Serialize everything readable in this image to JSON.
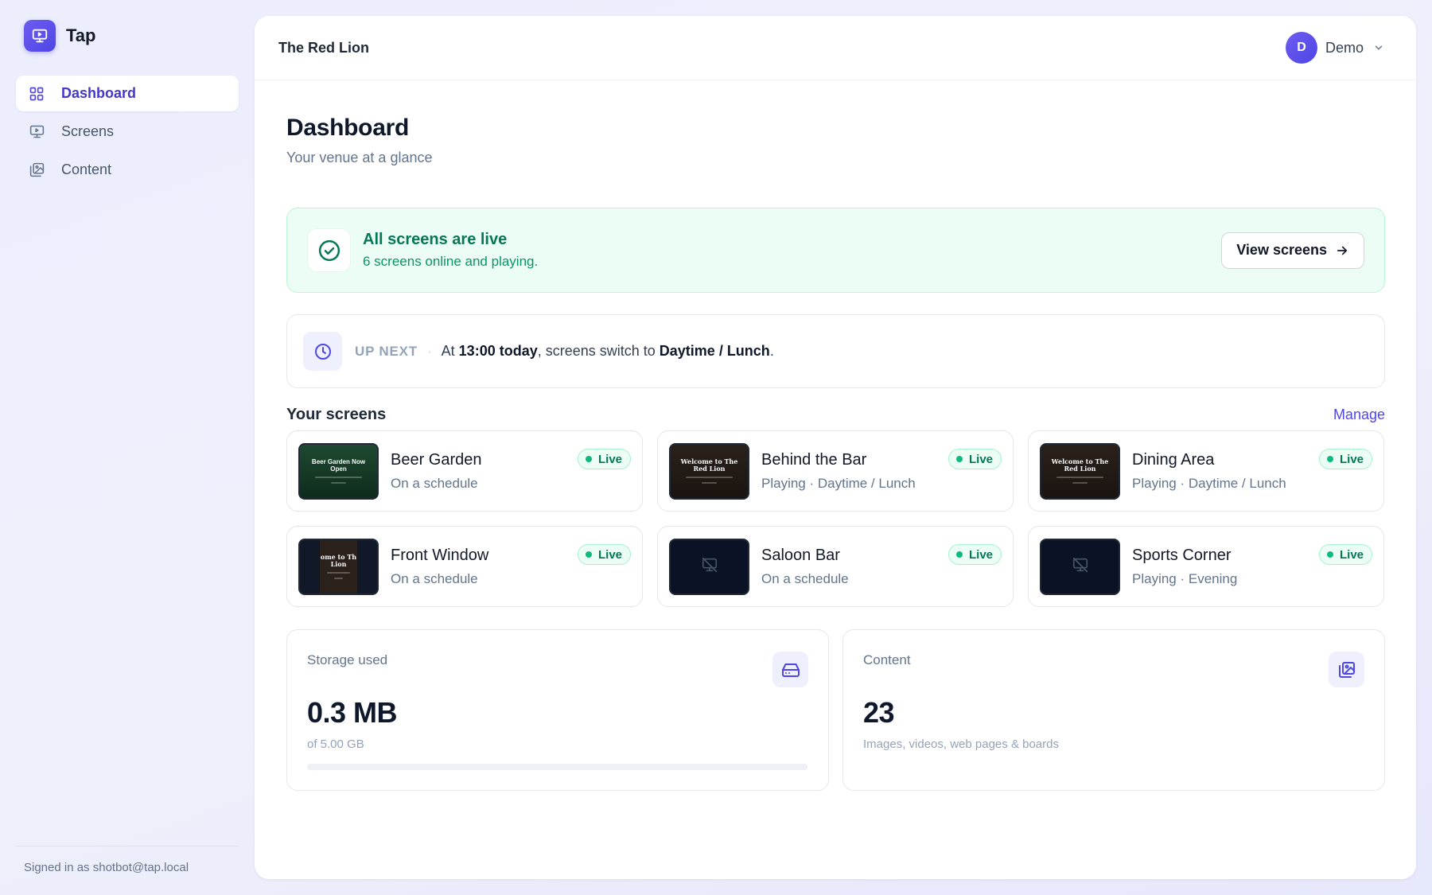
{
  "app": {
    "name": "Tap"
  },
  "sidebar": {
    "items": [
      {
        "label": "Dashboard",
        "icon": "grid-icon",
        "active": true
      },
      {
        "label": "Screens",
        "icon": "monitor-icon",
        "active": false
      },
      {
        "label": "Content",
        "icon": "images-icon",
        "active": false
      }
    ],
    "signed_in": "Signed in as shotbot@tap.local"
  },
  "topbar": {
    "venue": "The Red Lion",
    "user_initial": "D",
    "user_name": "Demo"
  },
  "page": {
    "title": "Dashboard",
    "subtitle": "Your venue at a glance"
  },
  "banner": {
    "title": "All screens are live",
    "subtitle": "6 screens online and playing.",
    "button": "View screens"
  },
  "up_next": {
    "label": "UP NEXT",
    "separator": "·",
    "prefix": "At ",
    "time": "13:00 today",
    "middle": ", screens switch to ",
    "schedule": "Daytime / Lunch",
    "suffix": "."
  },
  "screens": {
    "title": "Your screens",
    "manage": "Manage",
    "items": [
      {
        "name": "Beer Garden",
        "status": "On a schedule",
        "badge": "Live",
        "thumb_text": "Beer Garden Now Open",
        "thumb_style": "green"
      },
      {
        "name": "Behind the Bar",
        "status": "Playing · Daytime / Lunch",
        "badge": "Live",
        "thumb_text": "Welcome to The Red Lion",
        "thumb_style": "brown"
      },
      {
        "name": "Dining Area",
        "status": "Playing · Daytime / Lunch",
        "badge": "Live",
        "thumb_text": "Welcome to The Red Lion",
        "thumb_style": "brown"
      },
      {
        "name": "Front Window",
        "status": "On a schedule",
        "badge": "Live",
        "thumb_text": "ome to Th Lion",
        "thumb_style": "narrow-brown"
      },
      {
        "name": "Saloon Bar",
        "status": "On a schedule",
        "badge": "Live",
        "thumb_text": "",
        "thumb_style": "offline"
      },
      {
        "name": "Sports Corner",
        "status": "Playing · Evening",
        "badge": "Live",
        "thumb_text": "",
        "thumb_style": "offline"
      }
    ]
  },
  "storage": {
    "label": "Storage used",
    "value": "0.3 MB",
    "sub": "of 5.00 GB",
    "used_fraction": 0.0001
  },
  "content_stat": {
    "label": "Content",
    "value": "23",
    "sub": "Images, videos, web pages & boards"
  },
  "colors": {
    "accent": "#4f46e5",
    "live_green": "#10b981"
  }
}
